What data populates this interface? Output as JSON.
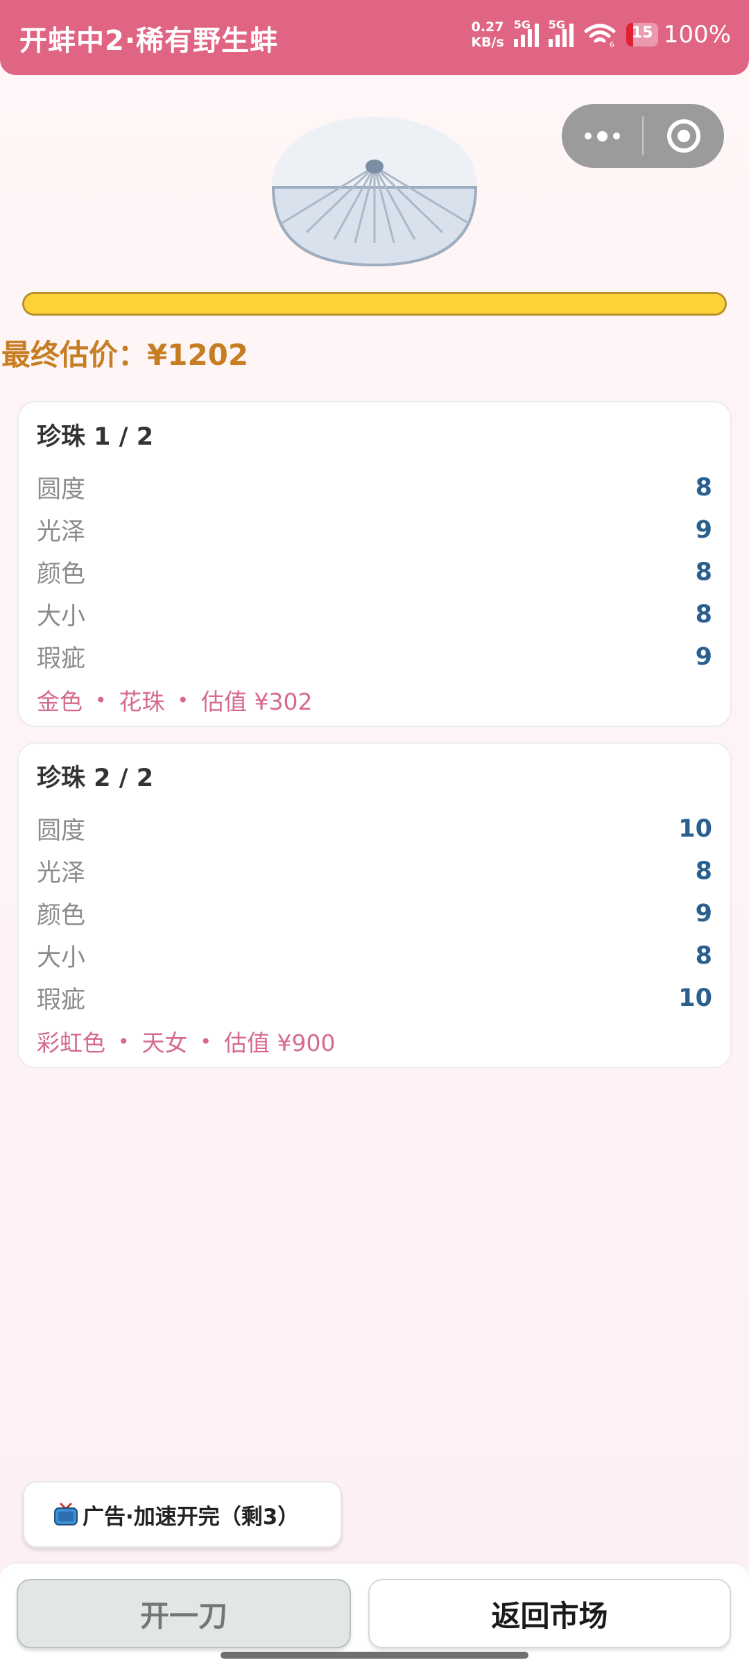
{
  "header": {
    "title": "开蚌中2·稀有野生蚌",
    "net_speed_value": "0.27",
    "net_speed_unit": "KB/s",
    "signal1_tag": "5G",
    "signal2_tag": "5G",
    "wifi_tag": "6",
    "battery_level_text": "15",
    "battery_percent": "100%"
  },
  "progress": {
    "fraction": 1.0
  },
  "final_price": "最终估价：¥1202",
  "pearls": [
    {
      "title": "珍珠 1 / 2",
      "attrs": [
        {
          "label": "圆度",
          "value": "8"
        },
        {
          "label": "光泽",
          "value": "9"
        },
        {
          "label": "颜色",
          "value": "8"
        },
        {
          "label": "大小",
          "value": "8"
        },
        {
          "label": "瑕疵",
          "value": "9"
        }
      ],
      "footer": [
        "金色",
        "花珠",
        "估值 ¥302"
      ]
    },
    {
      "title": "珍珠 2 / 2",
      "attrs": [
        {
          "label": "圆度",
          "value": "10"
        },
        {
          "label": "光泽",
          "value": "8"
        },
        {
          "label": "颜色",
          "value": "9"
        },
        {
          "label": "大小",
          "value": "8"
        },
        {
          "label": "瑕疵",
          "value": "10"
        }
      ],
      "footer": [
        "彩虹色",
        "天女",
        "估值 ¥900"
      ]
    }
  ],
  "footer_separator": "•",
  "ad_button": {
    "icon": "tv-icon",
    "label": "广告·加速开完（剩3）"
  },
  "actions": {
    "cut_label": "开一刀",
    "back_label": "返回市场"
  },
  "colors": {
    "header": "#e06583",
    "progress": "#fdd236",
    "price": "#c77d22",
    "value": "#2b5f8f",
    "footer_text": "#d56a8a"
  }
}
